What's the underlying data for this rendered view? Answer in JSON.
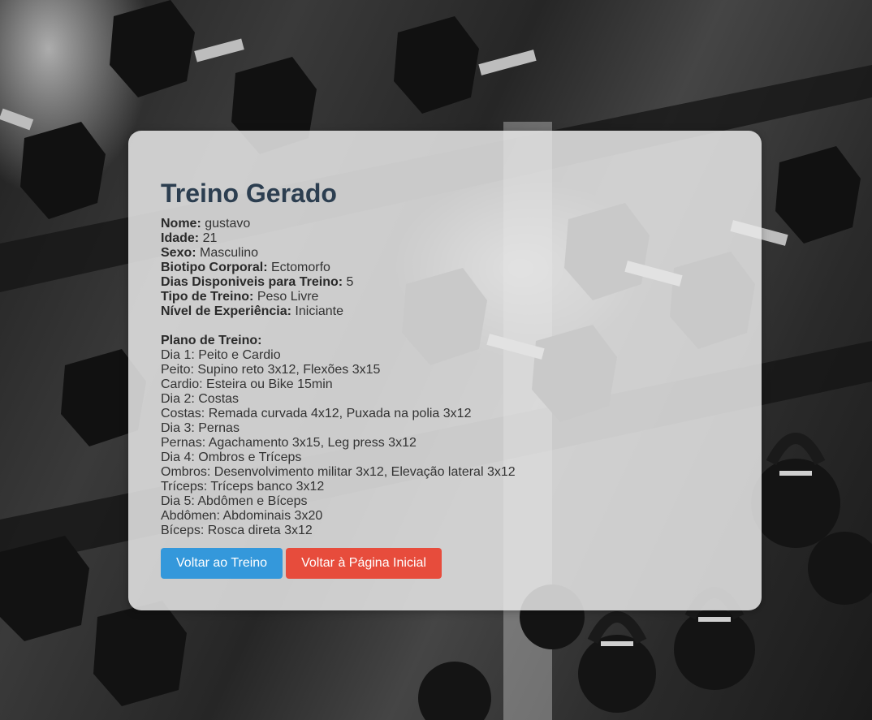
{
  "page": {
    "title": "Treino Gerado",
    "background_image": "gym dumbbell rack photo (grayscale)"
  },
  "profile": {
    "name_label": "Nome:",
    "name_value": "gustavo",
    "age_label": "Idade:",
    "age_value": "21",
    "sex_label": "Sexo:",
    "sex_value": "Masculino",
    "body_label": "Biotipo Corporal:",
    "body_value": "Ectomorfo",
    "days_label": "Dias Disponiveis para Treino:",
    "days_value": "5",
    "type_label": "Tipo de Treino:",
    "type_value": "Peso Livre",
    "level_label": "Nível de Experiência:",
    "level_value": "Iniciante"
  },
  "plan": {
    "title": "Plano de Treino:",
    "lines": [
      "Dia 1: Peito e Cardio",
      "Peito: Supino reto 3x12, Flexões 3x15",
      "Cardio: Esteira ou Bike 15min",
      "Dia 2: Costas",
      "Costas: Remada curvada 4x12, Puxada na polia 3x12",
      "Dia 3: Pernas",
      "Pernas: Agachamento 3x15, Leg press 3x12",
      "Dia 4: Ombros e Tríceps",
      "Ombros: Desenvolvimento militar 3x12, Elevação lateral 3x12",
      "Tríceps: Tríceps banco 3x12",
      "Dia 5: Abdômen e Bíceps",
      "Abdômen: Abdominais 3x20",
      "Bíceps: Rosca direta 3x12"
    ]
  },
  "buttons": {
    "back_to_training": "Voltar ao Treino",
    "back_to_home": "Voltar à Página Inicial"
  },
  "colors": {
    "title": "#2c3e50",
    "button_blue": "#3498db",
    "button_red": "#e74c3c",
    "card_bg": "rgba(232,232,232,0.86)"
  }
}
